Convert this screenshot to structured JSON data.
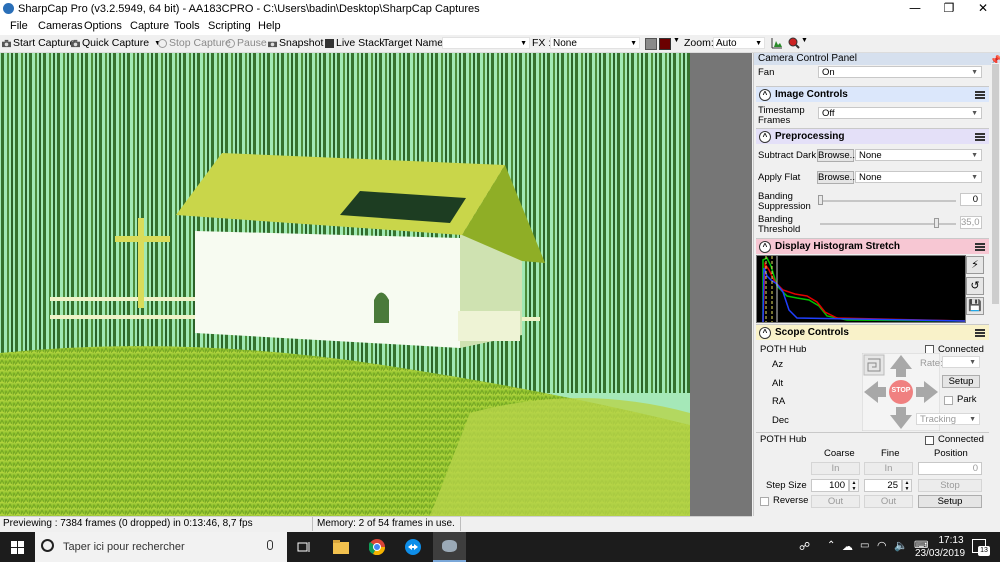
{
  "window": {
    "title": "SharpCap Pro (v3.2.5949, 64 bit) - AA183CPRO - C:\\Users\\badin\\Desktop\\SharpCap Captures",
    "minimize_glyph": "—",
    "maximize_glyph": "❐",
    "close_glyph": "✕"
  },
  "menu": [
    "File",
    "Cameras",
    "Options",
    "Capture",
    "Tools",
    "Scripting",
    "Help"
  ],
  "toolbar": {
    "start_capture": "Start Capture",
    "quick_capture": "Quick Capture",
    "stop_capture": "Stop Capture",
    "pause": "Pause",
    "snapshot": "Snapshot",
    "live_stack": "Live Stack",
    "target_name_label": "Target Name :",
    "target_name_value": "",
    "fx_label": "FX :",
    "fx_value": "None",
    "zoom_label": "Zoom:",
    "zoom_value": "Auto"
  },
  "status": {
    "previewing": "Previewing : 7384 frames (0 dropped) in 0:13:46, 8,7 fps",
    "memory": "Memory: 2 of 54 frames in use."
  },
  "panel": {
    "title": "Camera Control Panel",
    "fan_label": "Fan",
    "fan_value": "On",
    "image_controls": {
      "header": "Image Controls",
      "timestamp_label_1": "Timestamp",
      "timestamp_label_2": "Frames",
      "timestamp_value": "Off"
    },
    "preprocessing": {
      "header": "Preprocessing",
      "subtract_dark_label": "Subtract Dark",
      "apply_flat_label": "Apply Flat",
      "browse_label": "Browse...",
      "subtract_dark_value": "None",
      "apply_flat_value": "None",
      "banding_suppression_label_1": "Banding",
      "banding_suppression_label_2": "Suppression",
      "banding_suppression_value": "0",
      "banding_threshold_label_1": "Banding",
      "banding_threshold_label_2": "Threshold",
      "banding_threshold_value": "35,0"
    },
    "histogram": {
      "header": "Display Histogram Stretch"
    },
    "scope": {
      "header": "Scope Controls",
      "hub_label": "POTH Hub",
      "connected_label": "Connected",
      "axis_labels": [
        "Az",
        "Alt",
        "RA",
        "Dec"
      ],
      "rate_label": "Rate:",
      "setup_label": "Setup",
      "park_label": "Park",
      "tracking_label": "Tracking",
      "stop_label": "STOP"
    },
    "focuser": {
      "hub_label": "POTH Hub",
      "connected_label": "Connected",
      "coarse_label": "Coarse",
      "fine_label": "Fine",
      "position_label": "Position",
      "in_label": "In",
      "out_label": "Out",
      "position_value": "0",
      "step_size_label": "Step Size",
      "coarse_step": "100",
      "fine_step": "25",
      "stop_label": "Stop",
      "reverse_label": "Reverse",
      "setup_label": "Setup"
    }
  },
  "taskbar": {
    "search_placeholder": "Taper ici pour rechercher",
    "time": "17:13",
    "date": "23/03/2019",
    "notification_count": "13"
  }
}
